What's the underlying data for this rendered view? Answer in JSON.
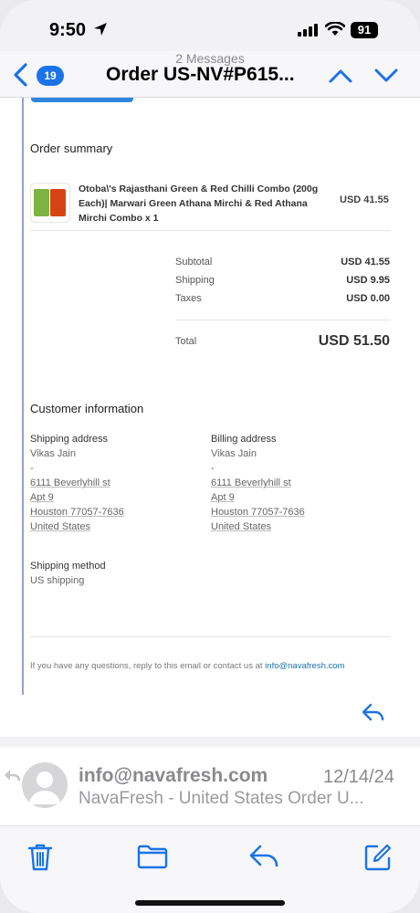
{
  "status": {
    "time": "9:50",
    "battery": "91"
  },
  "nav": {
    "message_count": "2 Messages",
    "back_count": "19",
    "subject": "Order US-NV#P615..."
  },
  "order": {
    "section_title": "Order summary",
    "item": {
      "name": "Otoba\\'s Rajasthani Green & Red Chilli Combo (200g Each)| Marwari Green Athana Mirchi & Red Athana Mirchi Combo x 1",
      "price": "USD 41.55"
    },
    "subtotal_label": "Subtotal",
    "subtotal_value": "USD 41.55",
    "shipping_label": "Shipping",
    "shipping_value": "USD 9.95",
    "taxes_label": "Taxes",
    "taxes_value": "USD 0.00",
    "total_label": "Total",
    "total_value": "USD 51.50"
  },
  "customer": {
    "section_title": "Customer information",
    "shipping_address": {
      "title": "Shipping address",
      "lines": [
        "Vikas Jain",
        "-",
        "6111 Beverlyhill st",
        "Apt 9",
        "Houston 77057-7636",
        "United States"
      ]
    },
    "billing_address": {
      "title": "Billing address",
      "lines": [
        "Vikas Jain",
        "-",
        "6111 Beverlyhill st",
        "Apt 9",
        "Houston 77057-7636",
        "United States"
      ]
    },
    "shipping_method_title": "Shipping method",
    "shipping_method_value": "US shipping"
  },
  "footer": {
    "text": "If you have any questions, reply to this email or contact us at ",
    "email": "info@navafresh.com"
  },
  "message2": {
    "from": "info@navafresh.com",
    "date": "12/14/24",
    "preview": "NavaFresh - United States Order U..."
  },
  "icons": {
    "accent": "#1a73e8",
    "names": [
      "location-arrow-icon",
      "signal-icon",
      "wifi-icon",
      "battery-icon",
      "back-chevron-icon",
      "up-chevron-icon",
      "down-chevron-icon",
      "reply-icon",
      "trash-icon",
      "folder-icon",
      "compose-icon"
    ]
  }
}
